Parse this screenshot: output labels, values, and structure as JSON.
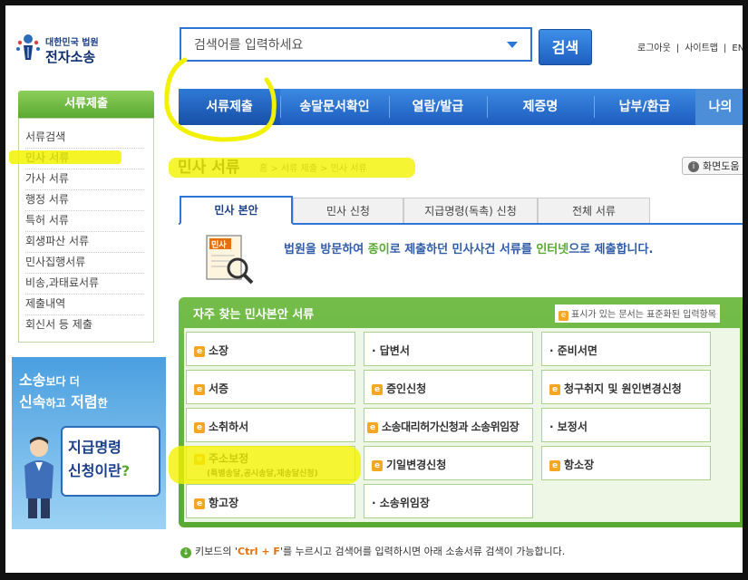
{
  "header": {
    "logo_line1": "대한민국 법원",
    "logo_line2": "전자소송",
    "search_placeholder": "검색어를 입력하세요",
    "search_button": "검색",
    "top_links": [
      "로그아웃",
      "|",
      "사이트맵",
      "|",
      "ENGI"
    ]
  },
  "nav": {
    "items": [
      "서류제출",
      "송달문서확인",
      "열람/발급",
      "제증명",
      "납부/환급",
      "나의"
    ]
  },
  "sidebar": {
    "title": "서류제출",
    "items": [
      "서류검색",
      "민사 서류",
      "가사 서류",
      "행정 서류",
      "특허 서류",
      "회생파산 서류",
      "민사집행서류",
      "비송,과태료서류",
      "제출내역",
      "회신서 등 제출"
    ]
  },
  "promo": {
    "line1_a": "소송",
    "line1_b": "보다 더",
    "line2_a": "신속",
    "line2_b": "하고",
    "line2_c": "저렴",
    "line2_d": "한",
    "card_line1": "지급명령",
    "card_line2": "신청이란",
    "card_q": "?"
  },
  "page": {
    "title": "민사 서류",
    "breadcrumb": "홈 > 서류 제출 > 민사 서류",
    "help": "화면도움"
  },
  "tabs": [
    "민사 본안",
    "민사 신청",
    "지급명령(독촉) 신청",
    "전체 서류"
  ],
  "intro": {
    "icon_label": "민사",
    "pre": "법원을 방문하여 ",
    "hl1": "종이",
    "mid": "로 제출하던 민사사건 서류를 ",
    "hl2": "인터넷",
    "post": "으로 제출합니다."
  },
  "panel": {
    "title": "자주 찾는 민사본안 서류",
    "note": "표시가 있는 문서는 표준화된 입력항목",
    "icon_label": "e",
    "cells": [
      {
        "label": "소장",
        "e": true
      },
      {
        "label": "답변서",
        "e": false
      },
      {
        "label": "준비서면",
        "e": false
      },
      {
        "label": "서증",
        "e": true
      },
      {
        "label": "증인신청",
        "e": true
      },
      {
        "label": "청구취지 및 원인변경신청",
        "e": true
      },
      {
        "label": "소취하서",
        "e": true
      },
      {
        "label": "소송대리허가신청과 소송위임장",
        "e": true
      },
      {
        "label": "보정서",
        "e": false
      },
      {
        "label": "주소보정",
        "sub": "(특별송달,공시송달,재송달신청)",
        "e": true
      },
      {
        "label": "기일변경신청",
        "e": true
      },
      {
        "label": "항소장",
        "e": true
      },
      {
        "label": "항고장",
        "e": true
      },
      {
        "label": "소송위임장",
        "e": false
      }
    ]
  },
  "hint": {
    "pre": "키보드의 '",
    "key": "Ctrl + F",
    "post": "'를 누르시고 검색어를 입력하시면 아래 소송서류 검색이 가능합니다."
  },
  "colors": {
    "nav_blue": "#2f75d6",
    "green": "#5aa932",
    "highlighter": "#f2f200"
  }
}
